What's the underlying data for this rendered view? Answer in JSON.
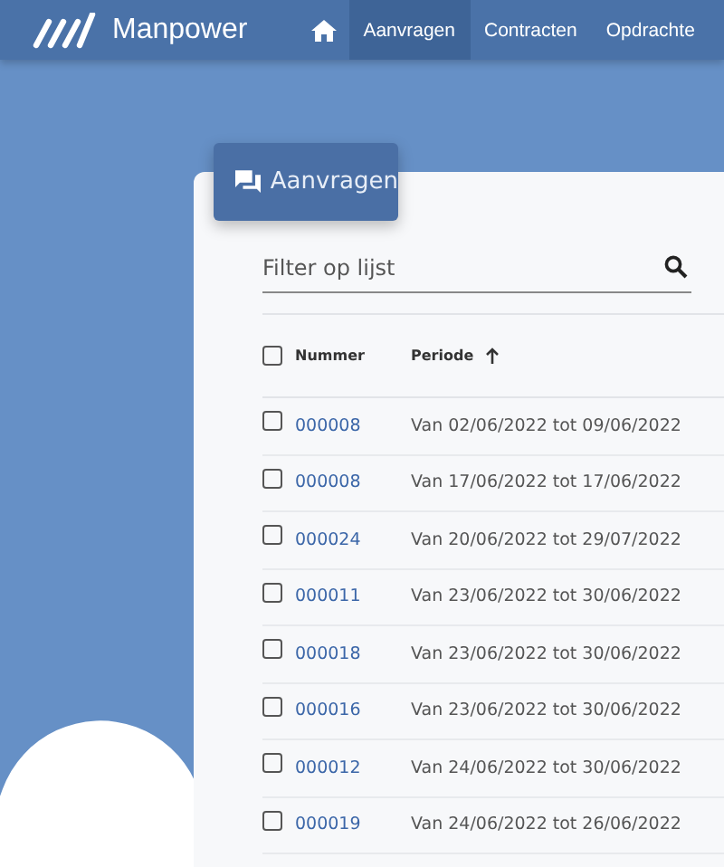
{
  "header": {
    "logo": "Manpower",
    "nav": [
      {
        "label": "Aanvragen",
        "selected": true
      },
      {
        "label": "Contracten",
        "selected": false
      },
      {
        "label": "Opdrachte",
        "selected": false
      }
    ]
  },
  "card": {
    "tab": "Aanvragen",
    "filter": {
      "placeholder": "Filter op lijst"
    },
    "table": {
      "select_all": {
        "checked": false
      },
      "columns": [
        {
          "label": "Nummer",
          "sorted": false
        },
        {
          "label": "Periode",
          "sorted": true
        }
      ],
      "rows": [
        {
          "checked": false,
          "nummer": "000008",
          "periode": "Van 02/06/2022 tot 09/06/2022"
        },
        {
          "checked": false,
          "nummer": "000008",
          "periode": "Van 17/06/2022 tot 17/06/2022"
        },
        {
          "checked": false,
          "nummer": "000024",
          "periode": "Van 20/06/2022 tot 29/07/2022"
        },
        {
          "checked": false,
          "nummer": "000011",
          "periode": "Van 23/06/2022 tot 30/06/2022"
        },
        {
          "checked": false,
          "nummer": "000018",
          "periode": "Van 23/06/2022 tot 30/06/2022"
        },
        {
          "checked": false,
          "nummer": "000016",
          "periode": "Van 23/06/2022 tot 30/06/2022"
        },
        {
          "checked": false,
          "nummer": "000012",
          "periode": "Van 24/06/2022 tot 30/06/2022"
        },
        {
          "checked": false,
          "nummer": "000019",
          "periode": "Van 24/06/2022 tot 26/06/2022"
        }
      ]
    }
  }
}
